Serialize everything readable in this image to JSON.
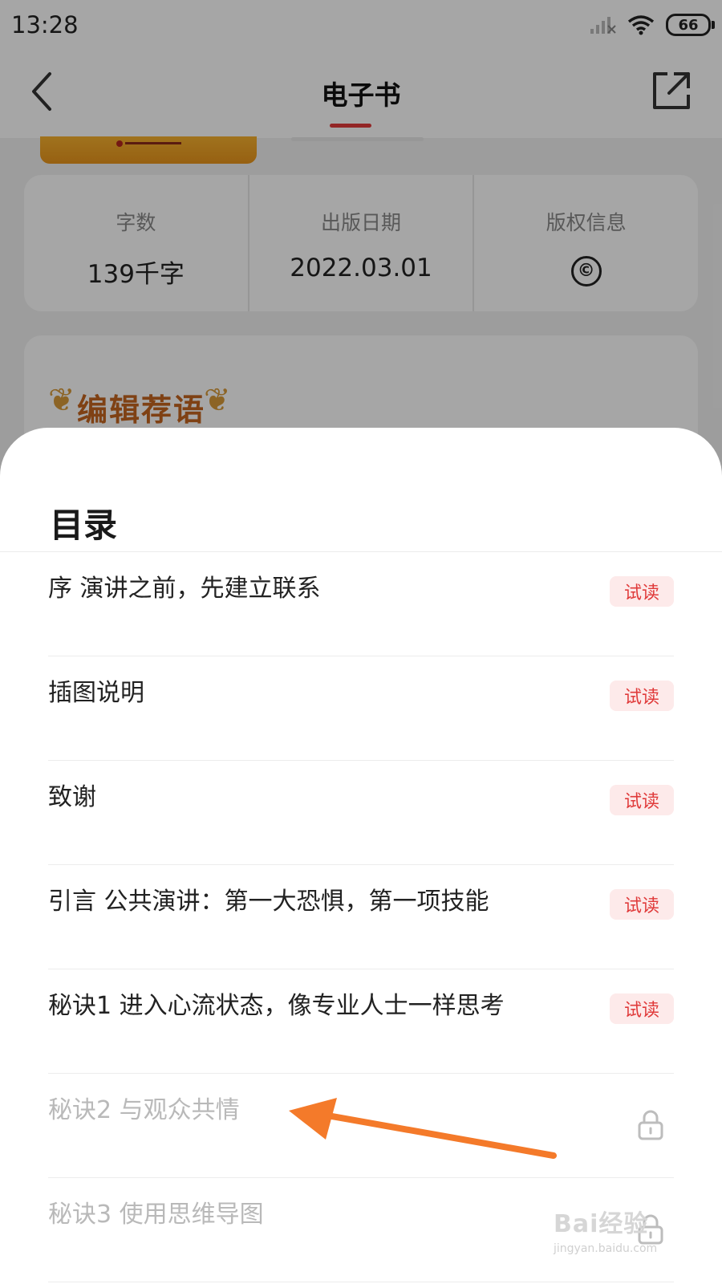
{
  "status": {
    "time": "13:28",
    "battery": "66"
  },
  "header": {
    "title": "电子书"
  },
  "info": [
    {
      "label": "字数",
      "value": "139千字"
    },
    {
      "label": "出版日期",
      "value": "2022.03.01"
    },
    {
      "label": "版权信息",
      "value": "©"
    }
  ],
  "editor": {
    "title": "编辑荐语"
  },
  "toc": {
    "title": "目录",
    "badge_label": "试读",
    "items": [
      {
        "label": "序 演讲之前，先建立联系",
        "locked": false
      },
      {
        "label": "插图说明",
        "locked": false
      },
      {
        "label": "致谢",
        "locked": false
      },
      {
        "label": "引言 公共演讲：第一大恐惧，第一项技能",
        "locked": false
      },
      {
        "label": "秘诀1 进入心流状态，像专业人士一样思考",
        "locked": false
      },
      {
        "label": "秘诀2 与观众共情",
        "locked": true
      },
      {
        "label": "秘诀3 使用思维导图",
        "locked": true
      }
    ]
  },
  "colors": {
    "accent": "#e23b3b",
    "badge_bg": "#fdeaea",
    "arrow": "#f47a2a"
  },
  "watermark": {
    "logo": "Bai经验",
    "url": "jingyan.baidu.com"
  }
}
